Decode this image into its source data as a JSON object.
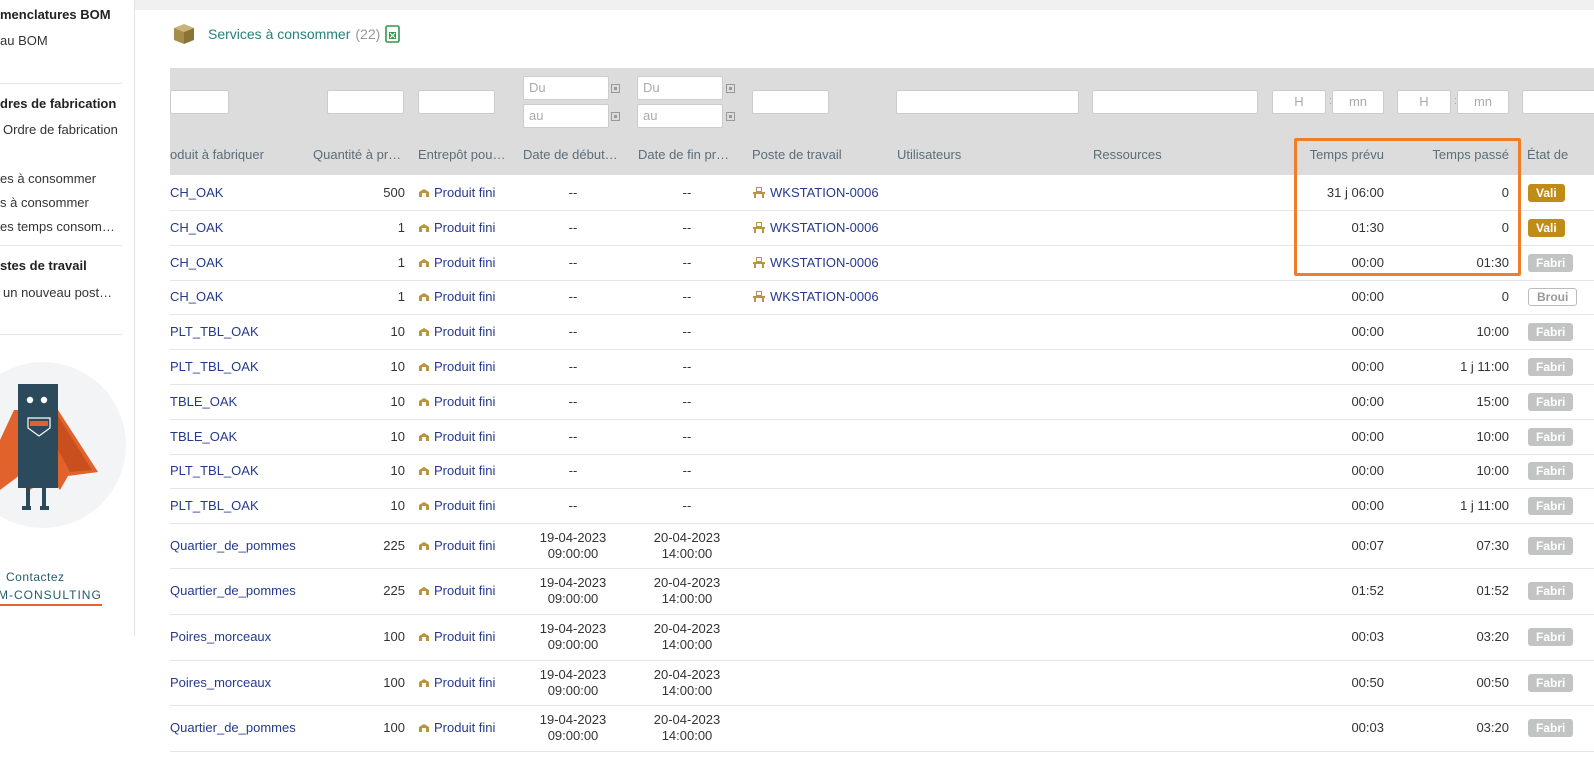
{
  "sidebar": {
    "section_bom": "menclatures BOM",
    "bom_new": "au BOM",
    "section_of": "dres de fabrication",
    "of_new": "Ordre de fabrication",
    "of_link1": "es à consommer",
    "of_link2": "s à consommer",
    "of_link3": "es temps consom…",
    "section_ws": "stes de travail",
    "ws_new": "un nouveau post…",
    "contact_line1": "Contactez",
    "contact_line2": "M-CONSULTING"
  },
  "header": {
    "title": "Services à consommer",
    "count": "(22)"
  },
  "filters": {
    "du": "Du",
    "au": "au",
    "h": "H",
    "mn": "mn"
  },
  "columns": {
    "produit": "oduit à fabriquer",
    "quantite": "Quantité à pr…",
    "entrepot": "Entrepôt pou…",
    "debut": "Date de début…",
    "fin": "Date de fin pr…",
    "poste": "Poste de travail",
    "utilisateurs": "Utilisateurs",
    "ressources": "Ressources",
    "temps_prevu": "Temps prévu",
    "temps_passe": "Temps passé",
    "etat": "État de"
  },
  "rows": [
    {
      "produit": "CH_OAK",
      "qty": "500",
      "entrepot": "Produit fini",
      "debut": "--",
      "fin": "--",
      "poste": "WKSTATION-0006",
      "prevu": "31 j 06:00",
      "passe": "0",
      "etat": "Vali",
      "etat_type": "valid"
    },
    {
      "produit": "CH_OAK",
      "qty": "1",
      "entrepot": "Produit fini",
      "debut": "--",
      "fin": "--",
      "poste": "WKSTATION-0006",
      "prevu": "01:30",
      "passe": "0",
      "etat": "Vali",
      "etat_type": "valid"
    },
    {
      "produit": "CH_OAK",
      "qty": "1",
      "entrepot": "Produit fini",
      "debut": "--",
      "fin": "--",
      "poste": "WKSTATION-0006",
      "prevu": "00:00",
      "passe": "01:30",
      "etat": "Fabri",
      "etat_type": "fab"
    },
    {
      "produit": "CH_OAK",
      "qty": "1",
      "entrepot": "Produit fini",
      "debut": "--",
      "fin": "--",
      "poste": "WKSTATION-0006",
      "prevu": "00:00",
      "passe": "0",
      "etat": "Broui",
      "etat_type": "brou"
    },
    {
      "produit": "PLT_TBL_OAK",
      "qty": "10",
      "entrepot": "Produit fini",
      "debut": "--",
      "fin": "--",
      "poste": "",
      "prevu": "00:00",
      "passe": "10:00",
      "etat": "Fabri",
      "etat_type": "fab"
    },
    {
      "produit": "PLT_TBL_OAK",
      "qty": "10",
      "entrepot": "Produit fini",
      "debut": "--",
      "fin": "--",
      "poste": "",
      "prevu": "00:00",
      "passe": "1 j 11:00",
      "etat": "Fabri",
      "etat_type": "fab"
    },
    {
      "produit": "TBLE_OAK",
      "qty": "10",
      "entrepot": "Produit fini",
      "debut": "--",
      "fin": "--",
      "poste": "",
      "prevu": "00:00",
      "passe": "15:00",
      "etat": "Fabri",
      "etat_type": "fab"
    },
    {
      "produit": "TBLE_OAK",
      "qty": "10",
      "entrepot": "Produit fini",
      "debut": "--",
      "fin": "--",
      "poste": "",
      "prevu": "00:00",
      "passe": "10:00",
      "etat": "Fabri",
      "etat_type": "fab"
    },
    {
      "produit": "PLT_TBL_OAK",
      "qty": "10",
      "entrepot": "Produit fini",
      "debut": "--",
      "fin": "--",
      "poste": "",
      "prevu": "00:00",
      "passe": "10:00",
      "etat": "Fabri",
      "etat_type": "fab"
    },
    {
      "produit": "PLT_TBL_OAK",
      "qty": "10",
      "entrepot": "Produit fini",
      "debut": "--",
      "fin": "--",
      "poste": "",
      "prevu": "00:00",
      "passe": "1 j 11:00",
      "etat": "Fabri",
      "etat_type": "fab"
    },
    {
      "produit": "Quartier_de_pommes",
      "qty": "225",
      "entrepot": "Produit fini",
      "debut_date": "19-04-2023",
      "debut_time": "09:00:00",
      "fin_date": "20-04-2023",
      "fin_time": "14:00:00",
      "poste": "",
      "prevu": "00:07",
      "passe": "07:30",
      "etat": "Fabri",
      "etat_type": "fab"
    },
    {
      "produit": "Quartier_de_pommes",
      "qty": "225",
      "entrepot": "Produit fini",
      "debut_date": "19-04-2023",
      "debut_time": "09:00:00",
      "fin_date": "20-04-2023",
      "fin_time": "14:00:00",
      "poste": "",
      "prevu": "01:52",
      "passe": "01:52",
      "etat": "Fabri",
      "etat_type": "fab"
    },
    {
      "produit": "Poires_morceaux",
      "qty": "100",
      "entrepot": "Produit fini",
      "debut_date": "19-04-2023",
      "debut_time": "09:00:00",
      "fin_date": "20-04-2023",
      "fin_time": "14:00:00",
      "poste": "",
      "prevu": "00:03",
      "passe": "03:20",
      "etat": "Fabri",
      "etat_type": "fab"
    },
    {
      "produit": "Poires_morceaux",
      "qty": "100",
      "entrepot": "Produit fini",
      "debut_date": "19-04-2023",
      "debut_time": "09:00:00",
      "fin_date": "20-04-2023",
      "fin_time": "14:00:00",
      "poste": "",
      "prevu": "00:50",
      "passe": "00:50",
      "etat": "Fabri",
      "etat_type": "fab"
    },
    {
      "produit": "Quartier_de_pommes",
      "qty": "100",
      "entrepot": "Produit fini",
      "debut_date": "19-04-2023",
      "debut_time": "09:00:00",
      "fin_date": "20-04-2023",
      "fin_time": "14:00:00",
      "poste": "",
      "prevu": "00:03",
      "passe": "03:20",
      "etat": "Fabri",
      "etat_type": "fab"
    }
  ],
  "colors": {
    "header_teal": "#27817a",
    "link_blue": "#253a8e",
    "badge_validated": "#bf8d17",
    "badge_in_production": "#c2c4c4",
    "highlight_orange": "#f07d28",
    "table_header_bg": "#dcdcdc"
  }
}
